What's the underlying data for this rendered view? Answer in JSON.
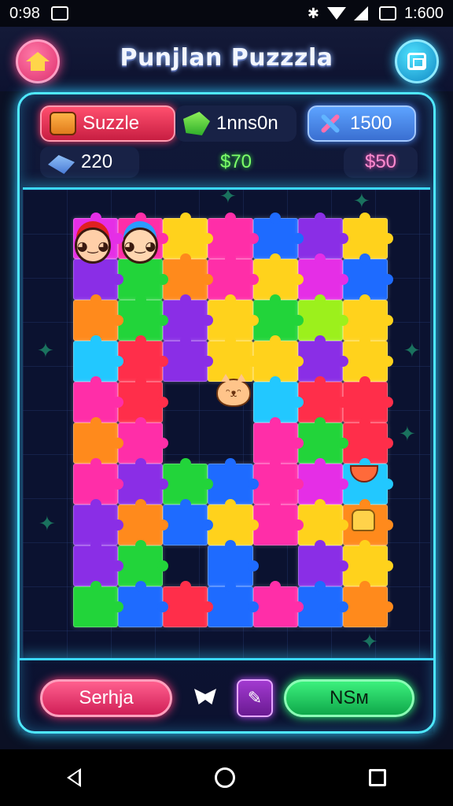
{
  "status_bar": {
    "time": "0:98",
    "right_label": "1:600",
    "icons": [
      "gallery-icon",
      "bluetooth-icon",
      "wifi-icon",
      "signal-icon",
      "battery-icon"
    ]
  },
  "header": {
    "title": "Punjlan Puzzzla",
    "left_icon": "home-icon",
    "right_icon": "menu-icon"
  },
  "stats": {
    "suzzle_label": "Suzzle",
    "moves_value": "1nns0n",
    "points_value": "1500",
    "level_value": "220",
    "mid_value": "$70",
    "right_value": "$50"
  },
  "board": {
    "columns": 7,
    "rows": 10,
    "pieces": [
      "magenta",
      "pink",
      "yellow",
      "pink",
      "blue",
      "purple",
      "yellow",
      "purple",
      "green",
      "orange",
      "pink",
      "yellow",
      "magenta",
      "blue",
      "orange",
      "green",
      "purple",
      "yellow",
      "green",
      "lime",
      "yellow",
      "cyan",
      "red",
      "purple",
      "yellow",
      "yellow",
      "purple",
      "yellow",
      "pink",
      "red",
      "empty",
      "empty",
      "cyan",
      "red",
      "red",
      "orange",
      "pink",
      "empty",
      "empty",
      "pink",
      "green",
      "red",
      "pink",
      "purple",
      "green",
      "blue",
      "pink",
      "magenta",
      "cyan",
      "purple",
      "orange",
      "blue",
      "yellow",
      "pink",
      "yellow",
      "orange",
      "purple",
      "green",
      "empty",
      "blue",
      "empty",
      "purple",
      "yellow",
      "green",
      "blue",
      "red",
      "blue",
      "pink",
      "blue",
      "orange"
    ]
  },
  "controls": {
    "left_button": "Serhja",
    "right_button": "NSм",
    "hint_icon": "hint-icon",
    "flag_icon": "flag-icon"
  },
  "nav": {
    "icons": [
      "back-icon",
      "home-circle-icon",
      "recent-apps-icon"
    ]
  }
}
